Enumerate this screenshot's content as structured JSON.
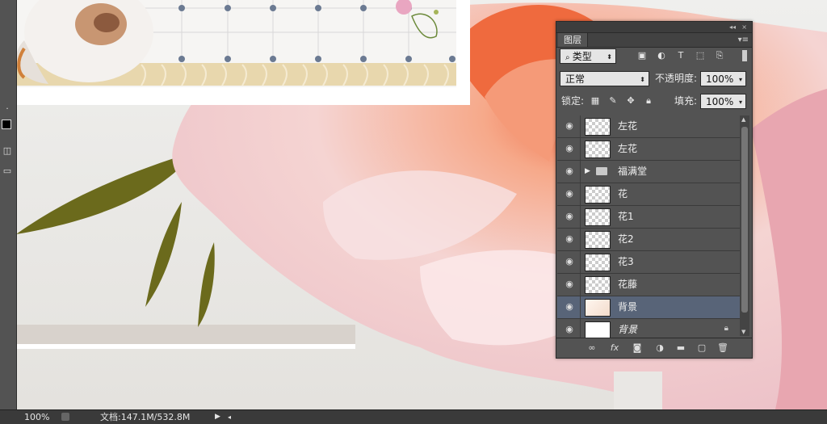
{
  "status": {
    "zoom": "100%",
    "doc_info": "文档:147.1M/532.8M"
  },
  "layers_panel": {
    "tab_label": "图层",
    "filter_kind": "类型",
    "blend_mode": "正常",
    "opacity_label": "不透明度:",
    "opacity_value": "100%",
    "lock_label": "锁定:",
    "fill_label": "填充:",
    "fill_value": "100%",
    "layers": [
      {
        "name": "左花",
        "kind": "pixel"
      },
      {
        "name": "左花",
        "kind": "pixel"
      },
      {
        "name": "福满堂",
        "kind": "group"
      },
      {
        "name": "花",
        "kind": "pixel"
      },
      {
        "name": "花1",
        "kind": "pixel"
      },
      {
        "name": "花2",
        "kind": "pixel"
      },
      {
        "name": "花3",
        "kind": "pixel"
      },
      {
        "name": "花藤",
        "kind": "pixel"
      },
      {
        "name": "背景",
        "kind": "pixel",
        "selected": true
      },
      {
        "name": "背景",
        "kind": "background",
        "locked": true
      }
    ]
  },
  "colors": {
    "panel_bg": "#535353",
    "selected_row": "#586478",
    "status_bg": "#3a3a3a"
  }
}
